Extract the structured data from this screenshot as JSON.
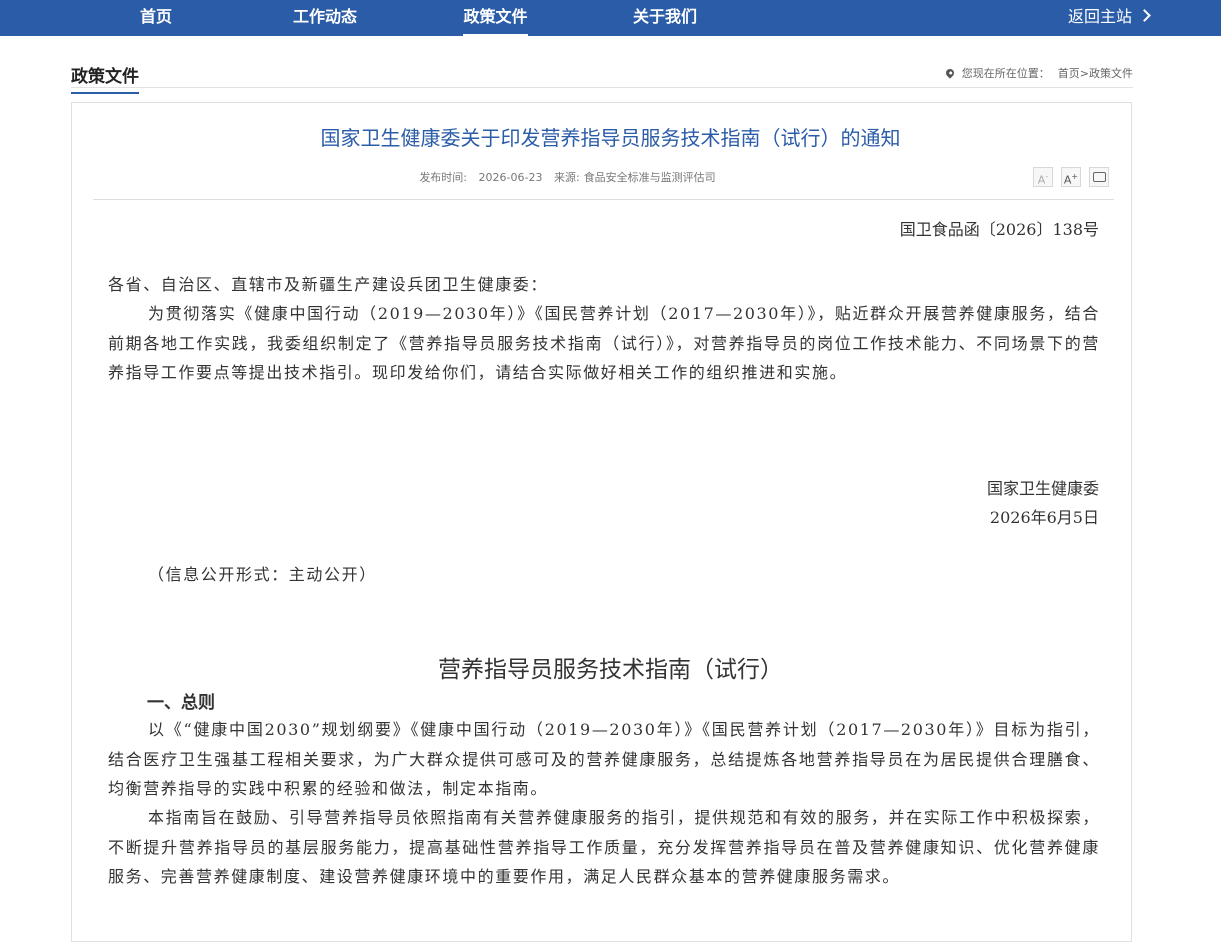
{
  "nav": {
    "items": [
      "首页",
      "工作动态",
      "政策文件",
      "关于我们"
    ],
    "back": "返回主站"
  },
  "section": {
    "title": "政策文件",
    "location_prefix": "您现在所在位置：",
    "crumb_home": "首页",
    "crumb_sep": ">",
    "crumb_current": "政策文件"
  },
  "article": {
    "title": "国家卫生健康委关于印发营养指导员服务技术指南（试行）的通知",
    "date_label": "发布时间:",
    "date": "2026-06-23",
    "source_label": "来源:",
    "source": "食品安全标准与监测评估司",
    "tools": [
      "A-",
      "A+",
      "print"
    ],
    "doc_number": "国卫食品函〔2026〕138号",
    "salutation": "各省、自治区、直辖市及新疆生产建设兵团卫生健康委：",
    "body": "为贯彻落实《健康中国行动（2019—2030年）》《国民营养计划（2017—2030年）》，贴近群众开展营养健康服务，结合前期各地工作实践，我委组织制定了《营养指导员服务技术指南（试行）》，对营养指导员的岗位工作技术能力、不同场景下的营养指导工作要点等提出技术指引。现印发给你们，请结合实际做好相关工作的组织推进和实施。",
    "signature": "国家卫生健康委",
    "sign_date": "2026年6月5日",
    "disclosure": "（信息公开形式：主动公开）"
  },
  "guide": {
    "title": "营养指导员服务技术指南（试行）",
    "section1": "一、总则",
    "p1": "以《“健康中国2030”规划纲要》《健康中国行动（2019—2030年）》《国民营养计划（2017—2030年）》目标为指引，结合医疗卫生强基工程相关要求，为广大群众提供可感可及的营养健康服务，总结提炼各地营养指导员在为居民提供合理膳食、均衡营养指导的实践中积累的经验和做法，制定本指南。",
    "p2": "本指南旨在鼓励、引导营养指导员依照指南有关营养健康服务的指引，提供规范和有效的服务，并在实际工作中积极探索，不断提升营养指导员的基层服务能力，提高基础性营养指导工作质量，充分发挥营养指导员在普及营养健康知识、优化营养健康服务、完善营养健康制度、建设营养健康环境中的重要作用，满足人民群众基本的营养健康服务需求。"
  },
  "colors": {
    "nav_bg": "#2b5ca8",
    "title": "#2b5ca8"
  }
}
